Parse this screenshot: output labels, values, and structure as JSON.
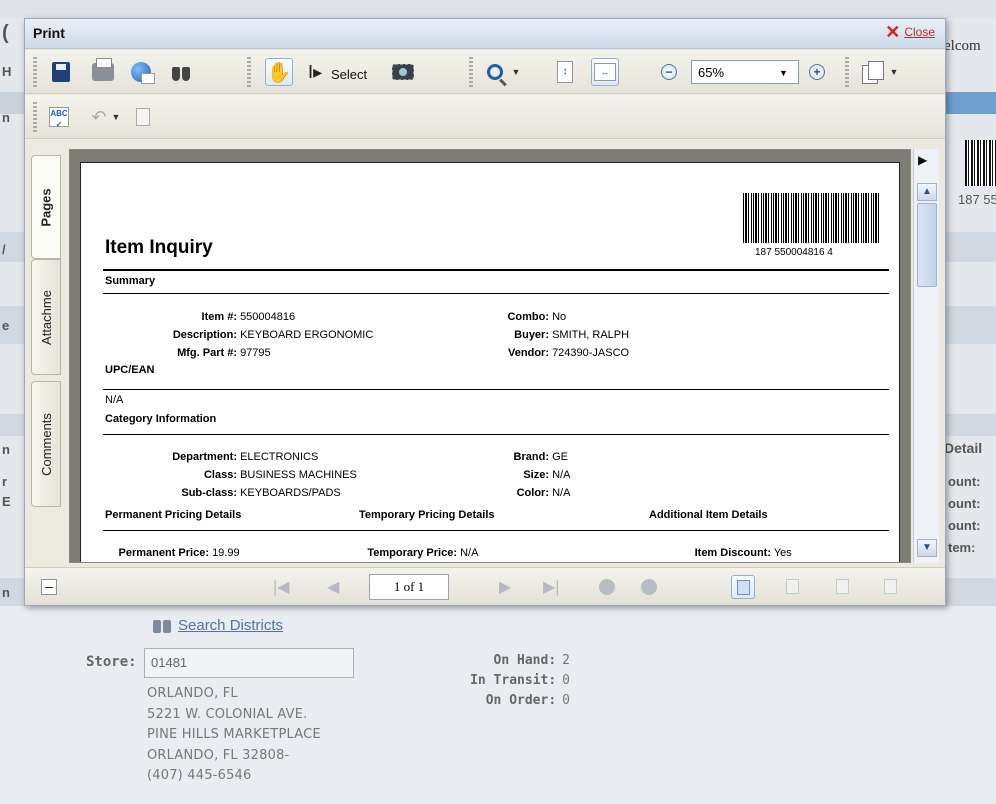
{
  "background": {
    "welcome_fragment": "elcom",
    "barcode_fragment": "187 55",
    "detail_fragment": "Detail",
    "count_fragments": [
      "ount:",
      "ount:",
      "ount:",
      "tem:"
    ],
    "left_letters": [
      "(",
      "H",
      "n",
      "/",
      "e",
      "n",
      "r",
      "E",
      "n"
    ],
    "search_districts": "Search Districts",
    "store_label": "Store:",
    "store_value": "01481",
    "store_address": [
      "ORLANDO, FL",
      "5221 W. COLONIAL AVE.",
      "PINE HILLS MARKETPLACE",
      "ORLANDO, FL 32808-",
      "(407) 445-6546"
    ],
    "stock": [
      {
        "label": "On Hand:",
        "value": "2"
      },
      {
        "label": "In Transit:",
        "value": "0"
      },
      {
        "label": "On Order:",
        "value": "0"
      }
    ]
  },
  "modal": {
    "title": "Print",
    "close_label": "Close",
    "toolbar": {
      "select_label": "Select",
      "zoom_value": "65%"
    },
    "tabs": [
      "Pages",
      "Attachme",
      "Comments"
    ],
    "nav": {
      "page_indicator": "1 of 1"
    }
  },
  "report": {
    "title": "Item Inquiry",
    "barcode_number": "187 550004816 4",
    "summary": {
      "heading": "Summary",
      "item_label": "Item #:",
      "item_value": "550004816",
      "desc_label": "Description:",
      "desc_value": "KEYBOARD ERGONOMIC",
      "mfg_label": "Mfg. Part #:",
      "mfg_value": "97795",
      "combo_label": "Combo:",
      "combo_value": "No",
      "buyer_label": "Buyer:",
      "buyer_value": "SMITH, RALPH",
      "vendor_label": "Vendor:",
      "vendor_value": "724390-JASCO"
    },
    "upc": {
      "heading": "UPC/EAN",
      "value": "N/A"
    },
    "category": {
      "heading": "Category Information",
      "dept_label": "Department:",
      "dept_value": "ELECTRONICS",
      "class_label": "Class:",
      "class_value": "BUSINESS MACHINES",
      "subclass_label": "Sub-class:",
      "subclass_value": "KEYBOARDS/PADS",
      "brand_label": "Brand:",
      "brand_value": "GE",
      "size_label": "Size:",
      "size_value": "N/A",
      "color_label": "Color:",
      "color_value": "N/A"
    },
    "pricing": {
      "permanent_heading": "Permanent Pricing Details",
      "temporary_heading": "Temporary Pricing Details",
      "additional_heading": "Additional Item Details",
      "perm_price_label": "Permanent Price:",
      "perm_price_value": "19.99",
      "temp_price_label": "Temporary Price:",
      "temp_price_value": "N/A",
      "discount_label": "Item Discount:",
      "discount_value": "Yes"
    }
  }
}
